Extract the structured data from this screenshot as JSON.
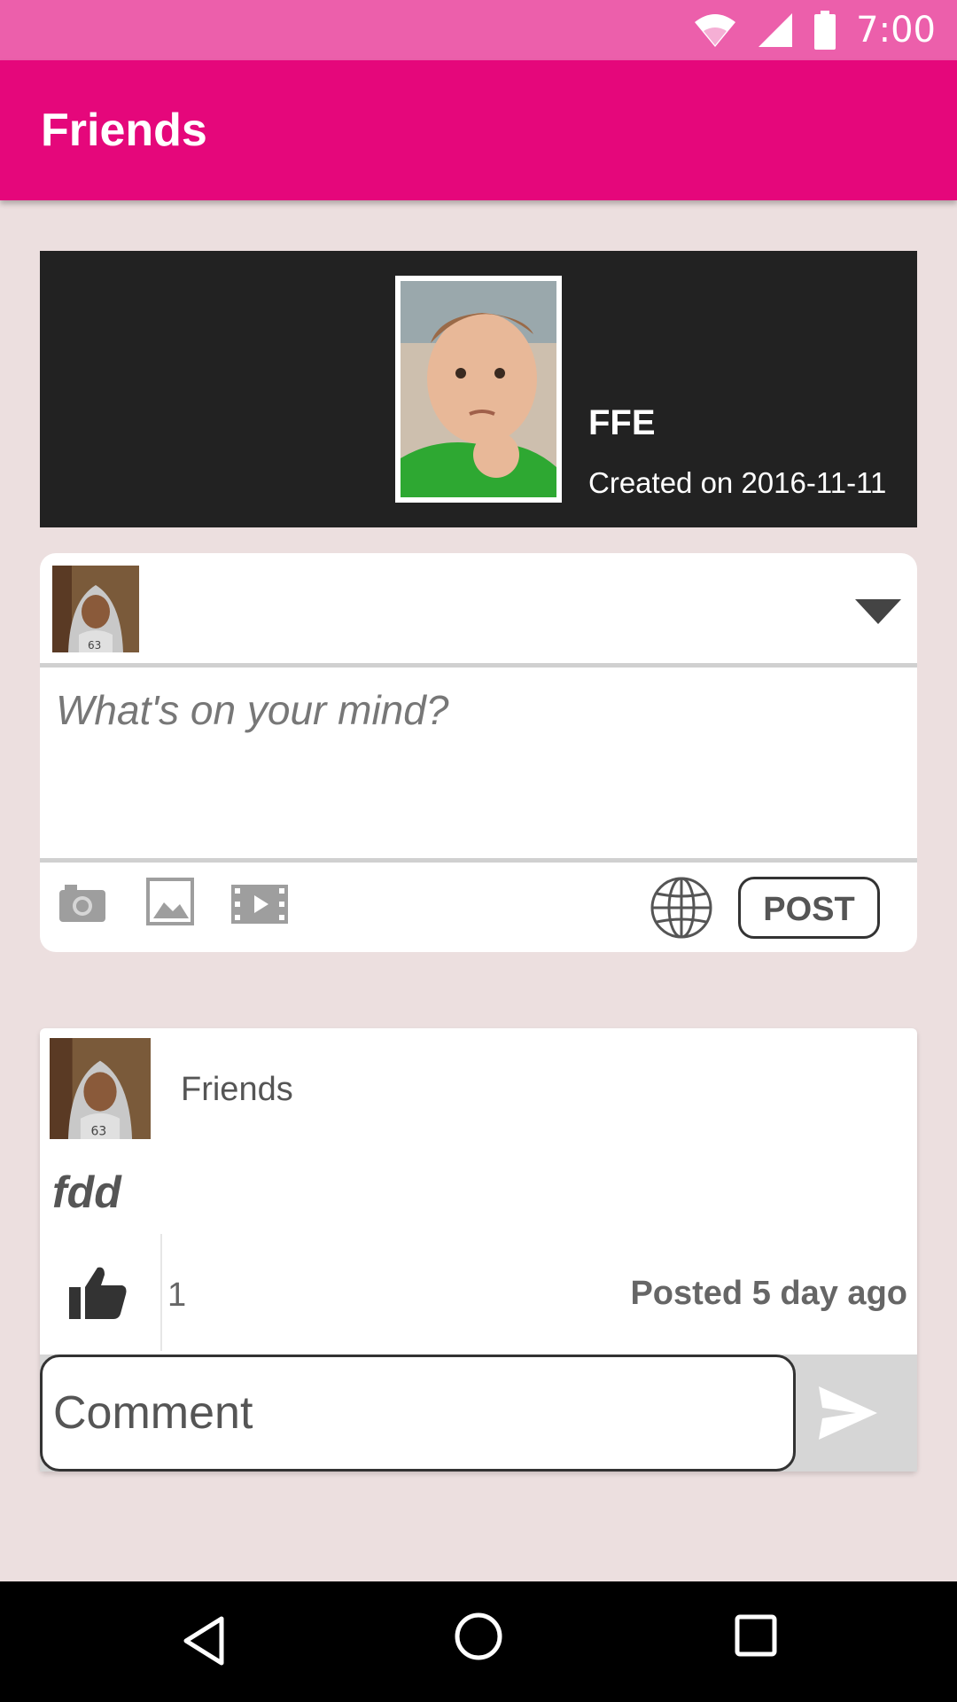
{
  "status_bar": {
    "time": "7:00",
    "icons": [
      "wifi-icon",
      "signal-icon",
      "battery-icon"
    ]
  },
  "app_bar": {
    "title": "Friends"
  },
  "group": {
    "name": "FFE",
    "created": "Created on 2016-11-11"
  },
  "composer": {
    "placeholder": "What's on your mind?",
    "tools": [
      "camera-icon",
      "image-icon",
      "video-icon",
      "globe-icon"
    ],
    "post_label": "POST"
  },
  "post": {
    "author": "Friends",
    "text": "fdd",
    "like_count": "1",
    "posted": "Posted 5 day ago",
    "comment_placeholder": "Comment"
  },
  "nav": {
    "buttons": [
      "back-icon",
      "home-icon",
      "recents-icon"
    ]
  },
  "colors": {
    "status_bar": "#ec5fab",
    "app_bar": "#e5077b",
    "background": "#ecdfdf",
    "group_header": "#222222"
  }
}
